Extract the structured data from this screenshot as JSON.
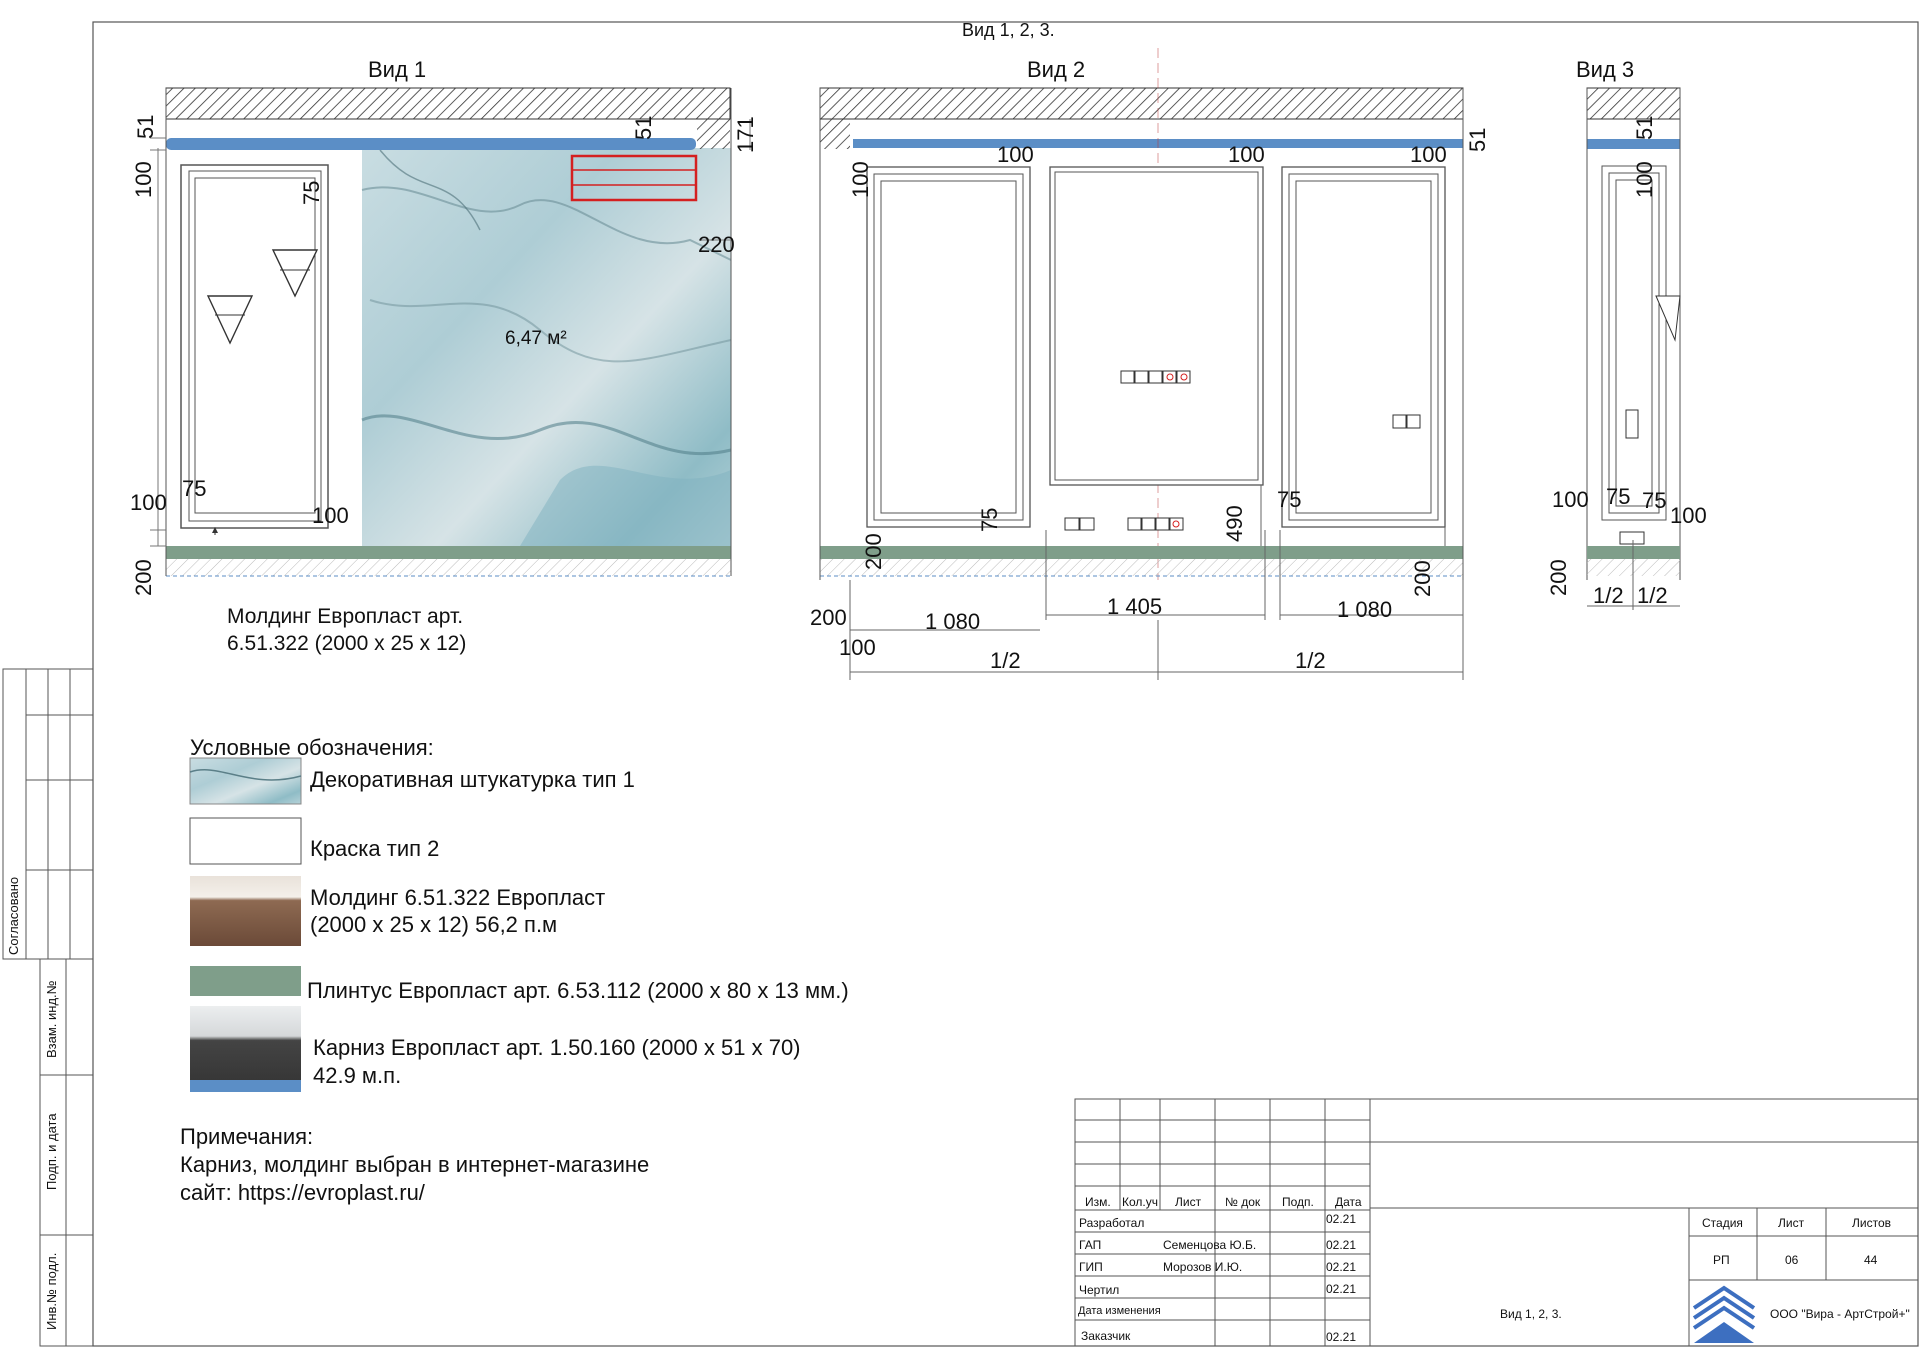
{
  "sheet_title": "Вид 1, 2, 3.",
  "views": {
    "v1": {
      "title": "Вид 1",
      "dims": {
        "d51a": "51",
        "d100a": "100",
        "d75a": "75",
        "d51b": "51",
        "d171": "171",
        "d220": "220",
        "d100b": "100",
        "d75b": "75",
        "d100c": "100",
        "d200": "200"
      },
      "area_label": "6,47 м²",
      "molding_note_line1": "Молдинг Европласт арт.",
      "molding_note_line2": "6.51.322 (2000 х 25 х 12)"
    },
    "v2": {
      "title": "Вид 2",
      "dims": {
        "d100a": "100",
        "d100b": "100",
        "d100c": "100",
        "d100v": "100",
        "d51": "51",
        "d75a": "75",
        "d490": "490",
        "d75b": "75",
        "d200a": "200",
        "d200b": "200",
        "d200c": "200",
        "d1080a": "1 080",
        "d1405": "1 405",
        "d1080b": "1 080",
        "d100d": "100",
        "half_a": "1/2",
        "half_b": "1/2"
      }
    },
    "v3": {
      "title": "Вид 3",
      "dims": {
        "d51": "51",
        "d100a": "100",
        "d100b": "100",
        "d75a": "75",
        "d75b": "75",
        "d100c": "100",
        "d200": "200",
        "half_a": "1/2",
        "half_b": "1/2"
      }
    }
  },
  "legend": {
    "heading": "Условные обозначения:",
    "items": [
      {
        "label1": "Декоративная штукатурка тип 1",
        "label2": ""
      },
      {
        "label1": "Краска  тип 2",
        "label2": ""
      },
      {
        "label1": "Молдинг 6.51.322 Европласт",
        "label2": " (2000 х 25 х 12) 56,2 п.м"
      },
      {
        "label1": "Плинтус Европласт арт. 6.53.112 (2000 х 80 х 13 мм.)",
        "label2": ""
      },
      {
        "label1": "Карниз Европласт арт.  1.50.160 (2000 х 51 х 70)",
        "label2": "42.9 м.п."
      }
    ]
  },
  "notes": {
    "heading": "Примечания:",
    "line1": "Карниз, молдинг выбран  в  интернет-магазине",
    "line2": "сайт: https://evroplast.ru/"
  },
  "left_stamps": {
    "s1": "Согласовано",
    "s2": "Взам. инд.№",
    "s3": "Подп. и дата",
    "s4": "Инв.№ подл."
  },
  "title_block": {
    "headers": {
      "izm": "Изм.",
      "kol": "Кол.уч",
      "list": "Лист",
      "ndoc": "№ док",
      "podp": "Подп.",
      "date": "Дата"
    },
    "rows": [
      {
        "role": "Разработал",
        "name": "",
        "date": "02.21"
      },
      {
        "role": "ГАП",
        "name": "Семенцова Ю.Б.",
        "date": "02.21"
      },
      {
        "role": "ГИП",
        "name": "Морозов И.Ю.",
        "date": "02.21"
      },
      {
        "role": "Чертил",
        "name": "",
        "date": "02.21"
      },
      {
        "role": "Дата изменения",
        "name": "",
        "date": ""
      },
      {
        "role": "Заказчик",
        "name": "",
        "date": "02.21"
      }
    ],
    "sheet_name": "Вид 1, 2, 3.",
    "stage_label": "Стадия",
    "list_label": "Лист",
    "lists_label": "Листов",
    "stage": "РП",
    "list": "06",
    "lists": "44",
    "company": "ООО \"Вира - АртСтрой+\""
  },
  "colors": {
    "cornice": "#5b8ec6",
    "plinth": "#7f9e8a",
    "marble": "#b7cfd6",
    "hatch": "#333333",
    "red": "#d42020"
  }
}
